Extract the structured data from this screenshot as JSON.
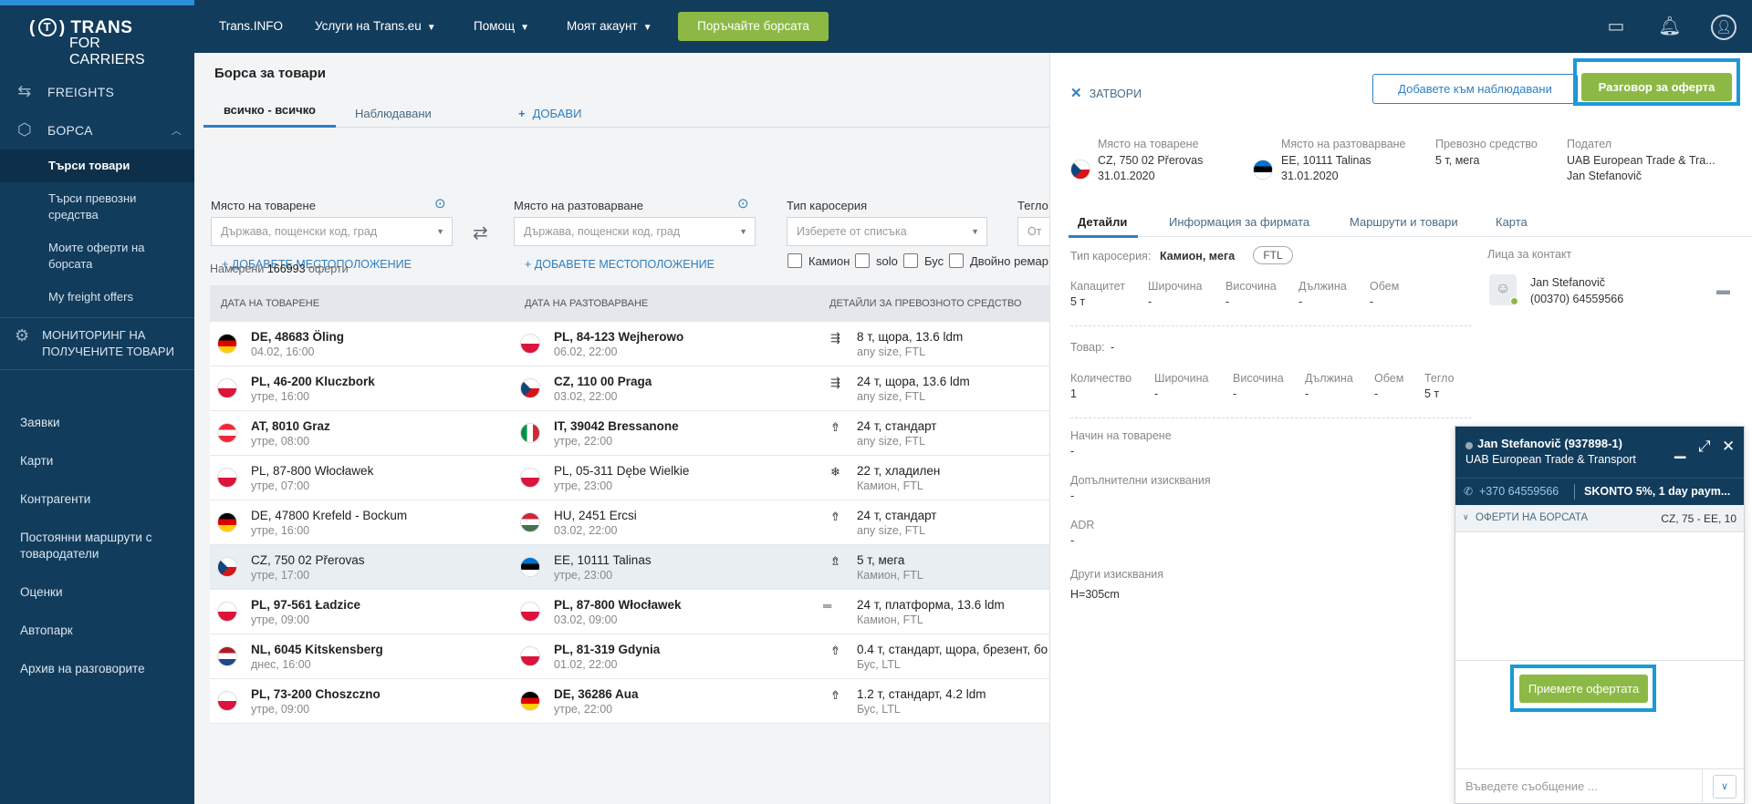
{
  "logo": {
    "line1_left": "(",
    "line1_circle": "T",
    "line1_right": ") TRANS",
    "line2": "FOR CARRIERS"
  },
  "sidebar": {
    "freights": "FREIGHTS",
    "borsa": "БОРСА",
    "sub": [
      "Търси товари",
      "Търси превозни средства",
      "Моите оферти на борсата",
      "My freight offers"
    ],
    "monitoring": "МОНИТОРИНГ НА ПОЛУЧЕНИТЕ ТОВАРИ",
    "second": [
      "Заявки",
      "Карти",
      "Контрагенти",
      "Постоянни маршрути с товародатели",
      "Оценки",
      "Автопарк",
      "Архив на разговорите"
    ]
  },
  "topbar": {
    "trans_info": "Trans.INFO",
    "services": "Услуги на Trans.eu",
    "help": "Помощ",
    "account": "Моят акаунт",
    "order_button": "Поръчайте борсата"
  },
  "main": {
    "title": "Борса за товари",
    "tabs": [
      "всичко - всичко",
      "Наблюдавани",
      "ДОБАВИ"
    ],
    "filters": {
      "loading_label": "Място на товарене",
      "loading_placeholder": "Държава, пощенски код, град",
      "unloading_label": "Място на разтоварване",
      "unloading_placeholder": "Държава, пощенски код, град",
      "body_label": "Тип каросерия",
      "body_placeholder": "Изберете от списъка",
      "weight_label": "Тегло",
      "weight_placeholder": "От",
      "add_location": "ДОБАВЕТЕ МЕСТОПОЛОЖЕНИЕ",
      "checkboxes": [
        "Камион",
        "solo",
        "Бус",
        "Двойно ремар"
      ]
    },
    "found_prefix": "Намерени",
    "found_count": "166993",
    "found_suffix": "оферти",
    "columns": [
      "ДАТА НА ТОВАРЕНЕ",
      "ДАТА НА РАЗТОВАРВАНЕ",
      "ДЕТАЙЛИ ЗА ПРЕВОЗНОТО СРЕДСТВО"
    ],
    "rows": [
      {
        "from": "DE, 48683 Öling",
        "from_date": "04.02, 16:00",
        "from_flag": "de",
        "to": "PL, 84-123 Wejherowo",
        "to_date": "06.02, 22:00",
        "to_flag": "pl",
        "vehicle": "8 т, щора, 13.6 ldm",
        "vehicle_sub": "any size, FTL",
        "icon": "⇶",
        "bold": true
      },
      {
        "from": "PL, 46-200 Kluczbork",
        "from_date": "утре, 16:00",
        "from_flag": "pl",
        "to": "CZ, 110 00 Praga",
        "to_date": "03.02, 22:00",
        "to_flag": "cz",
        "vehicle": "24 т, щора, 13.6 ldm",
        "vehicle_sub": "any size, FTL",
        "icon": "⇶",
        "bold": true
      },
      {
        "from": "AT, 8010 Graz",
        "from_date": "утре, 08:00",
        "from_flag": "at",
        "to": "IT, 39042 Bressanone",
        "to_date": "утре, 22:00",
        "to_flag": "it",
        "vehicle": "24 т, стандарт",
        "vehicle_sub": "any size, FTL",
        "icon": "⇮",
        "bold": true
      },
      {
        "from": "PL, 87-800 Włocławek",
        "from_date": "утре, 07:00",
        "from_flag": "pl",
        "to": "PL, 05-311 Dębe Wielkie",
        "to_date": "утре, 23:00",
        "to_flag": "pl",
        "vehicle": "22 т, хладилен",
        "vehicle_sub": "Камион, FTL",
        "icon": "❄",
        "bold": false
      },
      {
        "from": "DE, 47800 Krefeld - Bockum",
        "from_date": "утре, 16:00",
        "from_flag": "de",
        "to": "HU, 2451 Ercsi",
        "to_date": "03.02, 22:00",
        "to_flag": "hu",
        "vehicle": "24 т, стандарт",
        "vehicle_sub": "any size, FTL",
        "icon": "⇮",
        "bold": false
      },
      {
        "from": "CZ, 750 02 Přerovas",
        "from_date": "утре, 17:00",
        "from_flag": "cz",
        "to": "EE, 10111 Talinas",
        "to_date": "утре, 23:00",
        "to_flag": "ee",
        "vehicle": "5 т, мега",
        "vehicle_sub": "Камион, FTL",
        "icon": "⇯",
        "bold": false,
        "selected": true
      },
      {
        "from": "PL, 97-561 Ładzice",
        "from_date": "утре, 09:00",
        "from_flag": "pl",
        "to": "PL, 87-800 Włocławek",
        "to_date": "03.02, 09:00",
        "to_flag": "pl",
        "vehicle": "24 т, платформа, 13.6 ldm",
        "vehicle_sub": "Камион, FTL",
        "icon": "═",
        "bold": true
      },
      {
        "from": "NL, 6045 Kitskensberg",
        "from_date": "днес, 16:00",
        "from_flag": "nl",
        "to": "PL, 81-319 Gdynia",
        "to_date": "01.02, 22:00",
        "to_flag": "pl",
        "vehicle": "0.4 т, стандарт, щора, брезент, бо",
        "vehicle_sub": "Бус, LTL",
        "icon": "⇮",
        "bold": true
      },
      {
        "from": "PL, 73-200 Choszczno",
        "from_date": "утре, 09:00",
        "from_flag": "pl",
        "to": "DE, 36286 Aua",
        "to_date": "утре, 22:00",
        "to_flag": "de",
        "vehicle": "1.2 т, стандарт, 4.2 ldm",
        "vehicle_sub": "Бус, LTL",
        "icon": "⇮",
        "bold": true
      }
    ]
  },
  "detail": {
    "close": "ЗАТВОРИ",
    "watch_button": "Добавете към наблюдавани",
    "offer_button": "Разговор за оферта",
    "summary": {
      "loading_label": "Място на товарене",
      "loading_place": "CZ, 750 02 Přerovas",
      "loading_date": "31.01.2020",
      "unloading_label": "Място на разтоварване",
      "unloading_place": "EE, 10111 Talinas",
      "unloading_date": "31.01.2020",
      "vehicle_label": "Превозно средство",
      "vehicle_value": "5 т, мега",
      "sender_label": "Подател",
      "sender_company": "UAB European Trade & Tra...",
      "sender_person": "Jan Stefanovič"
    },
    "tabs": [
      "Детайли",
      "Информация за фирмата",
      "Маршрути и товари",
      "Карта"
    ],
    "body_type_label": "Тип каросерия:",
    "body_type_value": "Камион, мега",
    "ftl": "FTL",
    "capacity": {
      "labels": [
        "Капацитет",
        "Широчина",
        "Височина",
        "Дължина",
        "Обем"
      ],
      "values": [
        "5 т",
        "-",
        "-",
        "-",
        "-"
      ]
    },
    "goods_label": "Товар:",
    "goods_value": "-",
    "quantity": {
      "labels": [
        "Количество",
        "Широчина",
        "Височина",
        "Дължина",
        "Обем",
        "Тегло"
      ],
      "values": [
        "1",
        "-",
        "-",
        "-",
        "-",
        "5 т"
      ]
    },
    "loading_start_label": "Начин на товарене",
    "loading_start_value": "-",
    "extra_label": "Допълнителни изисквания",
    "extra_value": "-",
    "adr_label": "ADR",
    "adr_value": "-",
    "other_label": "Други изисквания",
    "other_value": "H=305cm",
    "contacts_label": "Лица за контакт",
    "contact_name": "Jan Stefanovič",
    "contact_phone": "(00370) 64559566"
  },
  "chat": {
    "name": "Jan Stefanovič (937898-1)",
    "company": "UAB European Trade & Transport",
    "phone": "+370 64559566",
    "terms": "SKONTO 5%, 1 day paym...",
    "tab_label": "ОФЕРТИ НА БОРСАТА",
    "tab_route": "CZ, 75 - EE, 10",
    "accept_button": "Приемете офертата",
    "input_placeholder": "Въведете съобщение ..."
  },
  "colors": {
    "brand_navy": "#123c5c",
    "accent_green": "#8cb945",
    "accent_blue": "#2f7fc1",
    "highlight": "#1a9ad6"
  }
}
